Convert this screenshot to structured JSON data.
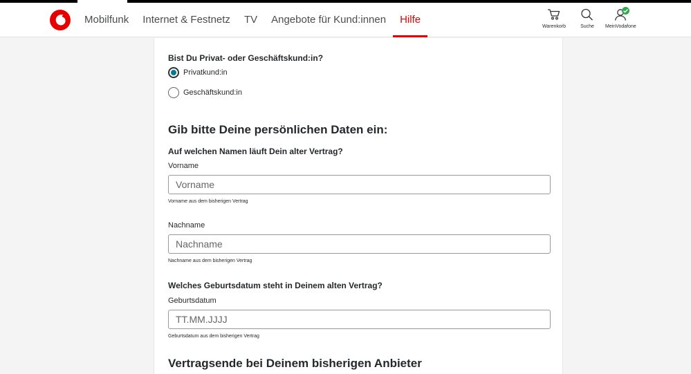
{
  "header": {
    "nav": [
      "Mobilfunk",
      "Internet & Festnetz",
      "TV",
      "Angebote für Kund:innen",
      "Hilfe"
    ],
    "active_nav": "Hilfe",
    "tools": {
      "cart": "Warenkorb",
      "search": "Suche",
      "account": "MeinVodafone"
    }
  },
  "form": {
    "customer_type_question": "Bist Du Privat- oder Geschäftskund:in?",
    "options": [
      {
        "label": "Privatkund:in",
        "selected": true
      },
      {
        "label": "Geschäftskund:in",
        "selected": false
      }
    ],
    "personal_title": "Gib bitte Deine persönlichen Daten ein:",
    "name_question": "Auf welchen Namen läuft Dein alter Vertrag?",
    "firstname": {
      "label": "Vorname",
      "placeholder": "Vorname",
      "value": "",
      "helper": "Vorname aus dem bisherigen Vertrag"
    },
    "lastname": {
      "label": "Nachname",
      "placeholder": "Nachname",
      "value": "",
      "helper": "Nachname aus dem bisherigen Vertrag"
    },
    "birthdate_question": "Welches Geburtsdatum steht in Deinem alten Vertrag?",
    "birthdate": {
      "label": "Geburtsdatum",
      "placeholder": "TT.MM.JJJJ",
      "value": "",
      "helper": "Geburtsdatum aus dem bisherigen Vertrag"
    },
    "contract_end_title": "Vertragsende bei Deinem bisherigen Anbieter"
  },
  "colors": {
    "brand": "#e60000",
    "radio_selected": "#007c92",
    "success": "#2fa84f"
  }
}
